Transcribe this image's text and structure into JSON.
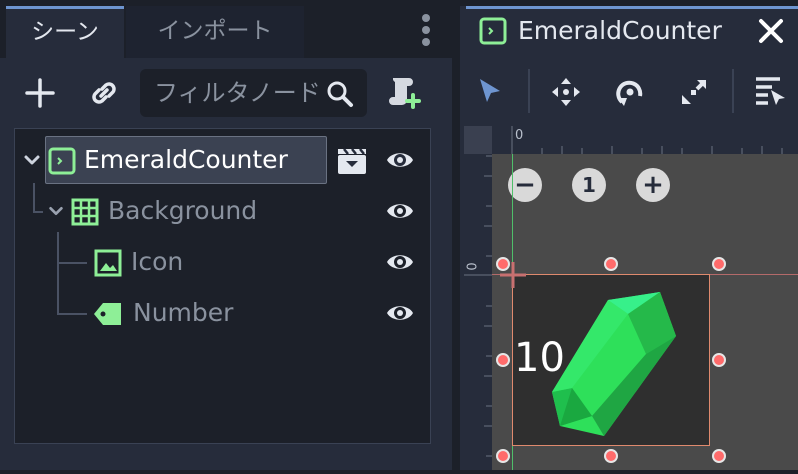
{
  "scene_dock": {
    "tabs": [
      {
        "label": "シーン",
        "active": true
      },
      {
        "label": "インポート",
        "active": false
      }
    ],
    "toolbar": {
      "add_icon": "plus-icon",
      "instance_icon": "link-icon",
      "filter_placeholder": "フィルタノード",
      "script_icon": "script-add-icon"
    },
    "tree": [
      {
        "name": "EmeraldCounter",
        "icon": "control-icon",
        "selected": true,
        "has_scene_icon": true,
        "visible": true
      },
      {
        "name": "Background",
        "icon": "grid-container-icon",
        "selected": false,
        "visible": true
      },
      {
        "name": "Icon",
        "icon": "texture-rect-icon",
        "selected": false,
        "visible": true
      },
      {
        "name": "Number",
        "icon": "label-icon",
        "selected": false,
        "visible": true
      }
    ]
  },
  "viewport": {
    "tab_title": "EmeraldCounter",
    "tools": [
      "select-tool-icon",
      "move-tool-icon",
      "rotate-tool-icon",
      "scale-tool-icon",
      "list-select-icon"
    ],
    "ruler_h_zero": "0",
    "ruler_v_zero": "0",
    "zoom": {
      "minus": "−",
      "reset": "1",
      "plus": "+"
    },
    "counter_text": "10"
  },
  "colors": {
    "accent": "#6e95d0",
    "node_green": "#8eef97",
    "handle": "#ff6b6b",
    "emerald": "#2ee05a"
  }
}
